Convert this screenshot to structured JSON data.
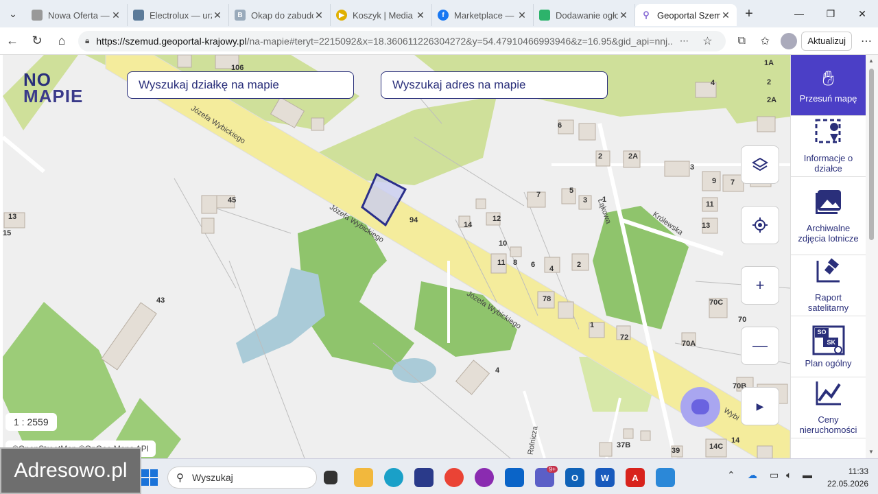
{
  "browser": {
    "tabs": [
      {
        "title": "Nowa Oferta — I",
        "color": "#888"
      },
      {
        "title": "Electrolux — urz",
        "color": "#5b7a99"
      },
      {
        "title": "Okap do zabudo",
        "color": "#9ab"
      },
      {
        "title": "Koszyk | Media E",
        "color": "#e0b000"
      },
      {
        "title": "Marketplace — Dz",
        "color": "#1877f2"
      },
      {
        "title": "Dodawanie ogło",
        "color": "#2db36b"
      },
      {
        "title": "Geoportal Szemu",
        "color": "#8a6fd6"
      }
    ],
    "url_domain": "https://szemud.geoportal-krajowy.pl",
    "url_rest": "/na-mapie#teryt=2215092&x=18.360611226304272&y=54.47910466993946&z=16.95&gid_api=nnj...",
    "update_label": "Aktualizuj"
  },
  "map": {
    "logo_line1": "NO",
    "logo_line2": "MAPIE",
    "search_parcel_placeholder": "Wyszukaj działkę na mapie",
    "search_address_placeholder": "Wyszukaj adres na mapie",
    "scale": "1 : 2559",
    "attribution": "©OpenStreetMap ©OnGeo Maps API",
    "streets": [
      "Józefa Wybickiego",
      "Józefa Wybickiego",
      "Józefa Wybickiego",
      "Królewska",
      "Łąkowa",
      "Wybi",
      "Rolnicza"
    ],
    "house_numbers": [
      "106",
      "45",
      "43",
      "94",
      "14",
      "12",
      "10",
      "11",
      "8",
      "6",
      "4",
      "7",
      "5",
      "3",
      "1",
      "2",
      "78",
      "72",
      "70C",
      "70",
      "70A",
      "70B",
      "37B",
      "39",
      "14C",
      "14",
      "13",
      "11",
      "9",
      "7",
      "5",
      "3",
      "2A",
      "2",
      "1A",
      "2A",
      "4",
      "6",
      "2",
      "1",
      "4",
      "15",
      "13"
    ]
  },
  "panel": {
    "items": [
      {
        "label": "Przesuń mapę",
        "icon": "hand-icon"
      },
      {
        "label": "Informacje o działce",
        "icon": "parcel-info-icon"
      },
      {
        "label": "Archiwalne zdjęcia lotnicze",
        "icon": "photo-icon"
      },
      {
        "label": "Raport satelitarny",
        "icon": "satellite-icon"
      },
      {
        "label": "Plan ogólny",
        "icon": "plan-icon"
      },
      {
        "label": "Ceny nieruchomości",
        "icon": "chart-icon"
      }
    ],
    "plan_badges": [
      "SO",
      "SK"
    ]
  },
  "taskbar": {
    "watermark": "Adresowo.pl",
    "search_placeholder": "Wyszukaj",
    "teams_badge": "9+",
    "time": "11:33",
    "date": "22.05.2026"
  }
}
